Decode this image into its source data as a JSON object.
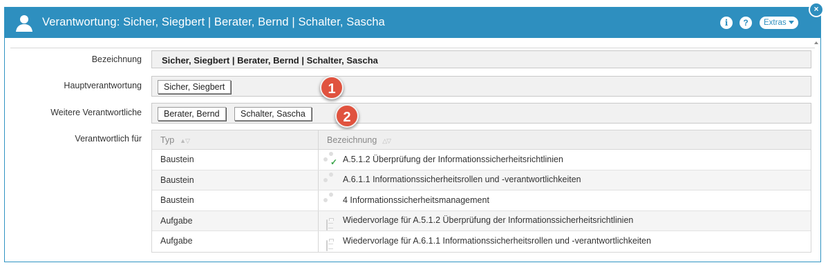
{
  "dialog": {
    "title": "Verantwortung: Sicher, Siegbert | Berater, Bernd | Schalter, Sascha",
    "extras_label": "Extras",
    "info_glyph": "i",
    "help_glyph": "?",
    "close_glyph": "×",
    "icons": {
      "title": "user-icon",
      "info": "info-icon",
      "help": "help-icon",
      "close": "close-icon"
    }
  },
  "form": {
    "bezeichnung": {
      "label": "Bezeichnung",
      "value": "Sicher, Siegbert | Berater, Bernd | Schalter, Sascha"
    },
    "hauptverantwortung": {
      "label": "Hauptverantwortung",
      "chips": [
        "Sicher, Siegbert"
      ]
    },
    "weitere": {
      "label": "Weitere Verantwortliche",
      "chips": [
        "Berater, Bernd",
        "Schalter, Sascha"
      ]
    },
    "verantwortlich_fuer": {
      "label": "Verantwortlich für"
    }
  },
  "badges": [
    "1",
    "2"
  ],
  "table": {
    "columns": [
      "Typ",
      "Bezeichnung"
    ],
    "rows": [
      {
        "typ": "Baustein",
        "bezeichnung": "A.5.1.2 Überprüfung der Informationssicherheitsrichtlinien",
        "icon": "puzzle-check-icon"
      },
      {
        "typ": "Baustein",
        "bezeichnung": "A.6.1.1 Informationssicherheitsrollen und -verantwortlichkeiten",
        "icon": "puzzle-icon"
      },
      {
        "typ": "Baustein",
        "bezeichnung": "4 Informationssicherheitsmanagement",
        "icon": "puzzle-icon"
      },
      {
        "typ": "Aufgabe",
        "bezeichnung": "Wiedervorlage für A.5.1.2 Überprüfung der Informationssicherheitsrichtlinien",
        "icon": "clipboard-icon"
      },
      {
        "typ": "Aufgabe",
        "bezeichnung": "Wiedervorlage für A.6.1.1 Informationssicherheitsrollen und -verantwortlichkeiten",
        "icon": "clipboard-icon"
      }
    ]
  },
  "colors": {
    "titlebar": "#2e8fbf",
    "badge": "#e0533f",
    "check": "#3aa54a"
  }
}
